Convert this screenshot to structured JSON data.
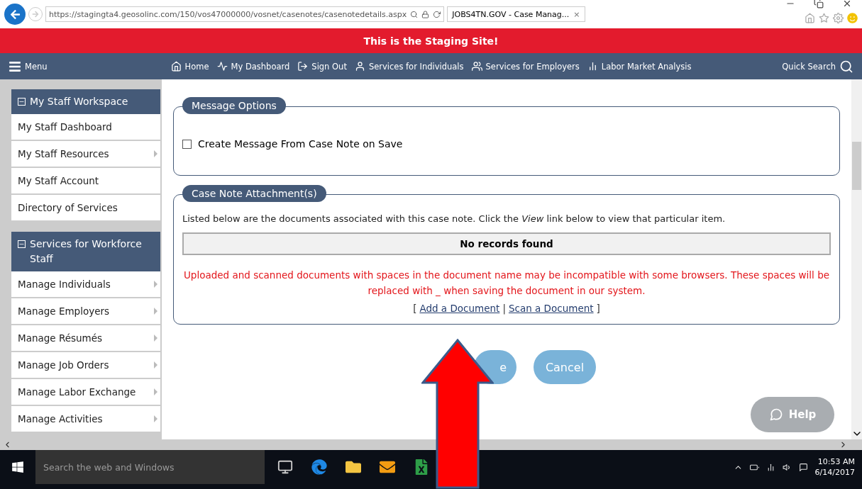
{
  "browser": {
    "url": "https://stagingta4.geosolinc.com/150/vos47000000/vosnet/casenotes/casenotedetails.aspx",
    "tab_title": "JOBS4TN.GOV - Case Manag...",
    "tab_close": "×"
  },
  "banner": "This is the Staging Site!",
  "nav": {
    "menu": "Menu",
    "items": [
      {
        "label": "Home"
      },
      {
        "label": "My Dashboard"
      },
      {
        "label": "Sign Out"
      },
      {
        "label": "Services for Individuals"
      },
      {
        "label": "Services for Employers"
      },
      {
        "label": "Labor Market Analysis"
      }
    ],
    "quick_search": "Quick Search"
  },
  "sidebar": [
    {
      "title": "My Staff Workspace",
      "expanded": true,
      "items": [
        {
          "label": "My Staff Dashboard",
          "submenu": false
        },
        {
          "label": "My Staff Resources",
          "submenu": true
        },
        {
          "label": "My Staff Account",
          "submenu": false
        },
        {
          "label": "Directory of Services",
          "submenu": false
        }
      ]
    },
    {
      "title": "Services for Workforce Staff",
      "expanded": true,
      "items": [
        {
          "label": "Manage Individuals",
          "submenu": true
        },
        {
          "label": "Manage Employers",
          "submenu": true
        },
        {
          "label": "Manage Résumés",
          "submenu": true
        },
        {
          "label": "Manage Job Orders",
          "submenu": true
        },
        {
          "label": "Manage Labor Exchange",
          "submenu": true
        },
        {
          "label": "Manage Activities",
          "submenu": true
        }
      ]
    }
  ],
  "message_options": {
    "legend": "Message Options",
    "checkbox": {
      "label": "Create Message From Case Note on Save",
      "checked": false
    }
  },
  "attachments": {
    "legend": "Case Note Attachment(s)",
    "intro": "Listed below are the documents associated with this case note. Click the *View* link below to view that particular item.",
    "empty": "No records found",
    "warning": "Uploaded and scanned documents with spaces in the document name may be incompatible with some browsers. These spaces will be replaced with _ when saving the document in our system.",
    "open": "[",
    "links": [
      "Add a Document",
      "Scan a Document"
    ],
    "separator": "|",
    "close": "]"
  },
  "buttons": [
    "e",
    "Cancel"
  ],
  "help": "Help",
  "taskbar": {
    "search": "Search the web and Windows",
    "time": "10:53 AM",
    "date": "6/14/2017"
  }
}
